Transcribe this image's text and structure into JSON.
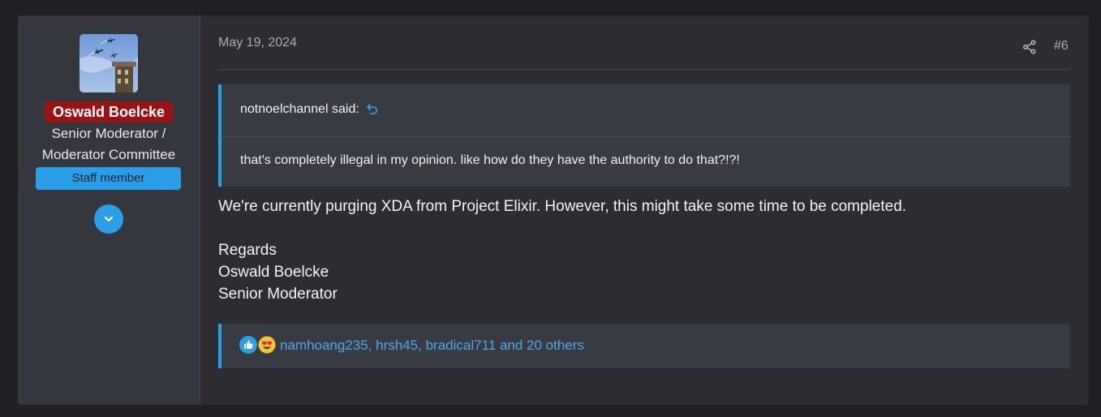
{
  "colors": {
    "username_bg": "#9b1215",
    "accent": "#2b9ee8",
    "staff_badge_bg": "#2b9ee8",
    "link": "#4aa9ee"
  },
  "user": {
    "avatar_icon": "airplanes-avatar-image",
    "name": "Oswald Boelcke",
    "title_line1": "Senior Moderator /",
    "title_line2": "Moderator Committee",
    "badge": "Staff member",
    "expand_icon": "chevron-down-icon"
  },
  "post": {
    "date": "May 19, 2024",
    "number": "#6",
    "share_icon": "share-icon"
  },
  "quote": {
    "author_said": "notnoelchannel said:",
    "jump_icon": "arrow-return-icon",
    "text": "that's completely illegal in my opinion. like how do they have the authority to do that?!?!"
  },
  "message": {
    "paragraph1": "We're currently purging XDA from Project Elixir. However, this might take some time to be completed.",
    "line_regards": "Regards",
    "line_name": "Oswald Boelcke",
    "line_role": "Senior Moderator"
  },
  "reactions": {
    "icons": [
      "like-icon",
      "love-eyes-icon"
    ],
    "users_text": "namhoang235, hrsh45, bradical711 and 20 others"
  }
}
